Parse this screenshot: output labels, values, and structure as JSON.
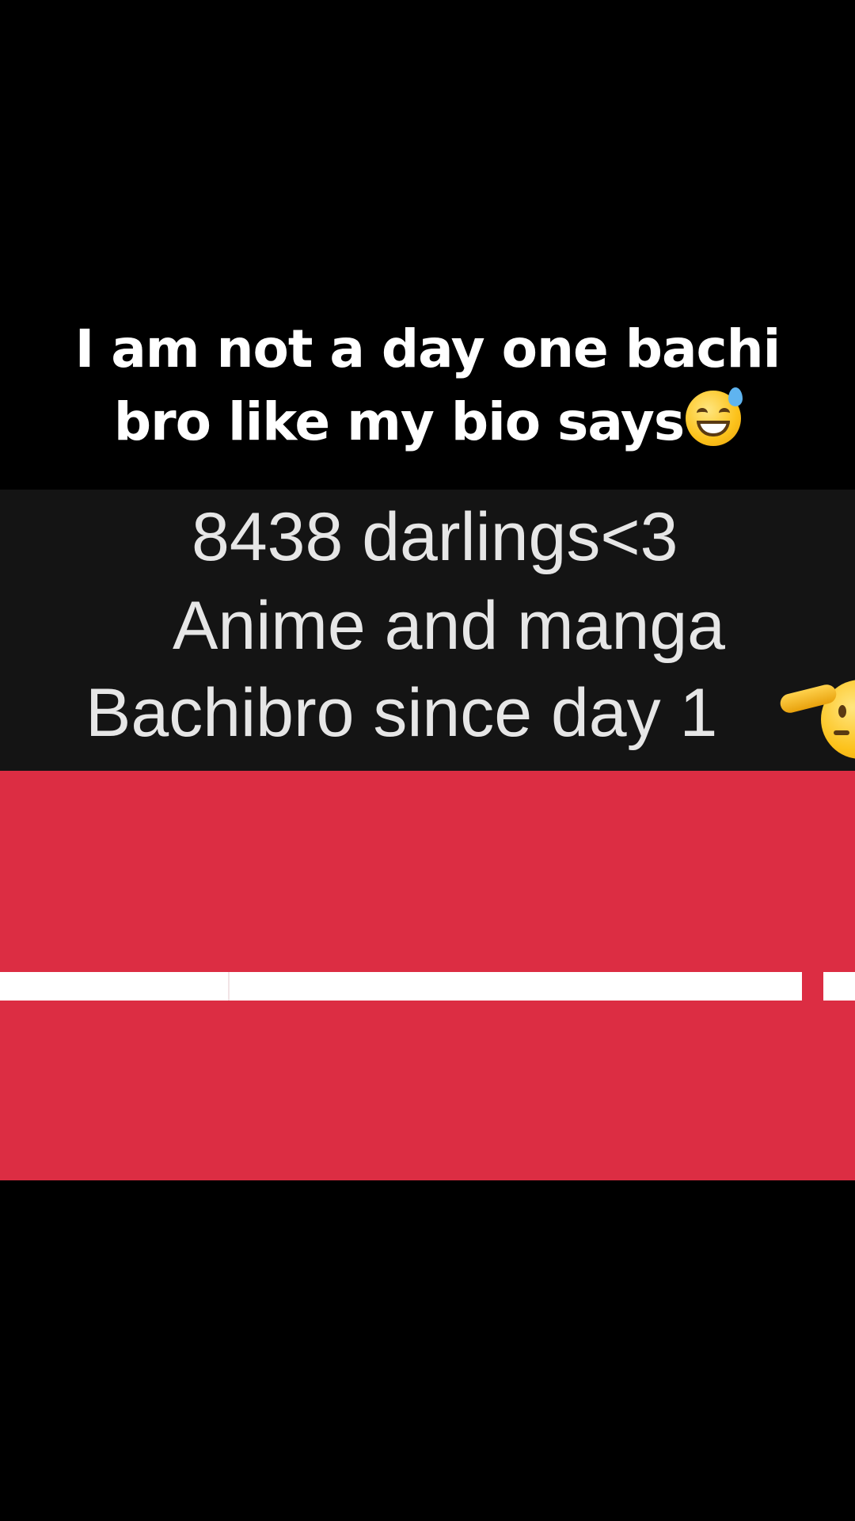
{
  "caption": {
    "line1": "I am not a day one bachi",
    "line2": "bro like my bio says"
  },
  "bio": {
    "line1": "8438 darlings<3",
    "line2": "Anime and manga",
    "line3": "Bachibro since day 1"
  },
  "icons": {
    "caption_emoji": "grinning-face-with-sweat-icon",
    "bio_emoji": "saluting-face-icon"
  },
  "colors": {
    "background": "#000000",
    "bio_panel": "#141414",
    "red_block": "#dc2d43",
    "bar": "#ffffff"
  }
}
